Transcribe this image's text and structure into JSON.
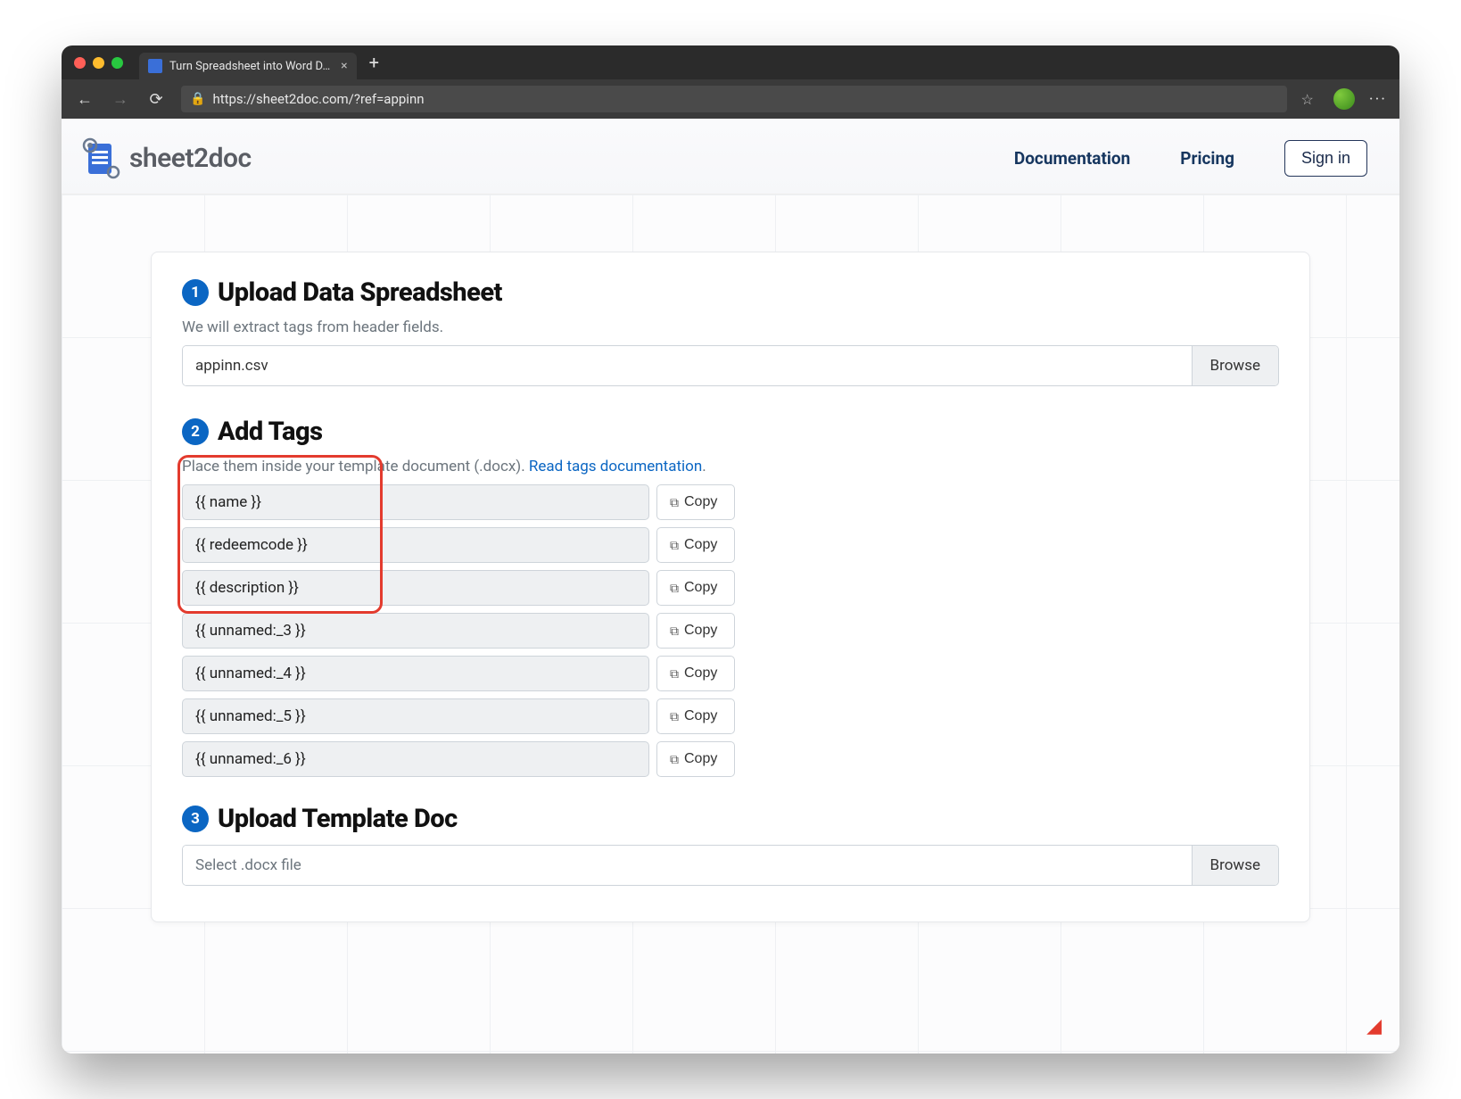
{
  "browser": {
    "tab_title": "Turn Spreadsheet into Word D…",
    "url": "https://sheet2doc.com/?ref=appinn"
  },
  "header": {
    "brand": "sheet2doc",
    "nav_docs": "Documentation",
    "nav_pricing": "Pricing",
    "signin": "Sign in"
  },
  "step1": {
    "num": "1",
    "title": "Upload Data Spreadsheet",
    "sub": "We will extract tags from header fields.",
    "filename": "appinn.csv",
    "browse": "Browse"
  },
  "step2": {
    "num": "2",
    "title": "Add Tags",
    "sub_prefix": "Place them inside your template document (.docx). ",
    "sub_link": "Read tags documentation",
    "sub_suffix": ".",
    "copy_label": "Copy",
    "tags": [
      "{{ name }}",
      "{{ redeemcode }}",
      "{{ description }}",
      "{{ unnamed:_3 }}",
      "{{ unnamed:_4 }}",
      "{{ unnamed:_5 }}",
      "{{ unnamed:_6 }}"
    ]
  },
  "step3": {
    "num": "3",
    "title": "Upload Template Doc",
    "placeholder": "Select .docx file",
    "browse": "Browse"
  }
}
